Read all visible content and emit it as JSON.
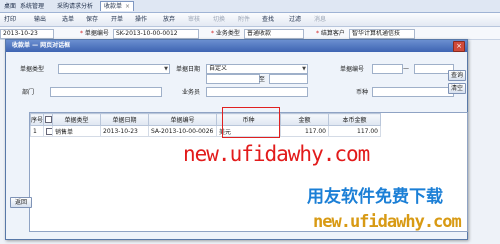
{
  "app": {
    "tabs": [
      {
        "label": "桌面"
      },
      {
        "label": "系统管理"
      },
      {
        "label": "采购请求分析"
      },
      {
        "label": "收款单"
      }
    ],
    "toolbar": [
      "打印",
      "输出",
      "选单",
      "保存",
      "开单",
      "操作",
      "放弃",
      "审核",
      "切换",
      "附件",
      "查找",
      "过滤",
      "消息"
    ],
    "header": {
      "date": "2013-10-23",
      "doc_no_label": "单据编号",
      "doc_no": "SK-2013-10-00-0012",
      "biz_type_label": "业务类型",
      "biz_type": "普通收款",
      "customer_label": "结算客户",
      "customer": "智华计算机通信技"
    }
  },
  "dialog": {
    "title": "收款单 — 网页对话框",
    "filters": {
      "doc_type_label": "单据类型",
      "doc_type_value": "",
      "doc_date_label": "单据日期",
      "doc_date_value": "自定义",
      "to_label": "至",
      "doc_no_label": "单据编号",
      "dept_label": "部门",
      "salesman_label": "业务员",
      "currency_label": "币种"
    },
    "buttons": {
      "query": "查询",
      "clear": "清空",
      "close": "×",
      "ok": "返回"
    },
    "grid": {
      "columns": [
        "序号",
        "",
        "单据类型",
        "单据日期",
        "单据编号",
        "币种",
        "金额",
        "本币金额"
      ],
      "rows": [
        {
          "seq": "1",
          "doc_type": "销售单",
          "doc_date": "2013-10-23",
          "doc_no": "SA-2013-10-00-0026",
          "currency": "美元",
          "amount": "117.00",
          "local_amount": "117.00"
        }
      ]
    }
  },
  "watermarks": {
    "red": "new.ufidawhy.com",
    "blue": "用友软件免费下载",
    "orange": "new.ufidawhy.com"
  }
}
